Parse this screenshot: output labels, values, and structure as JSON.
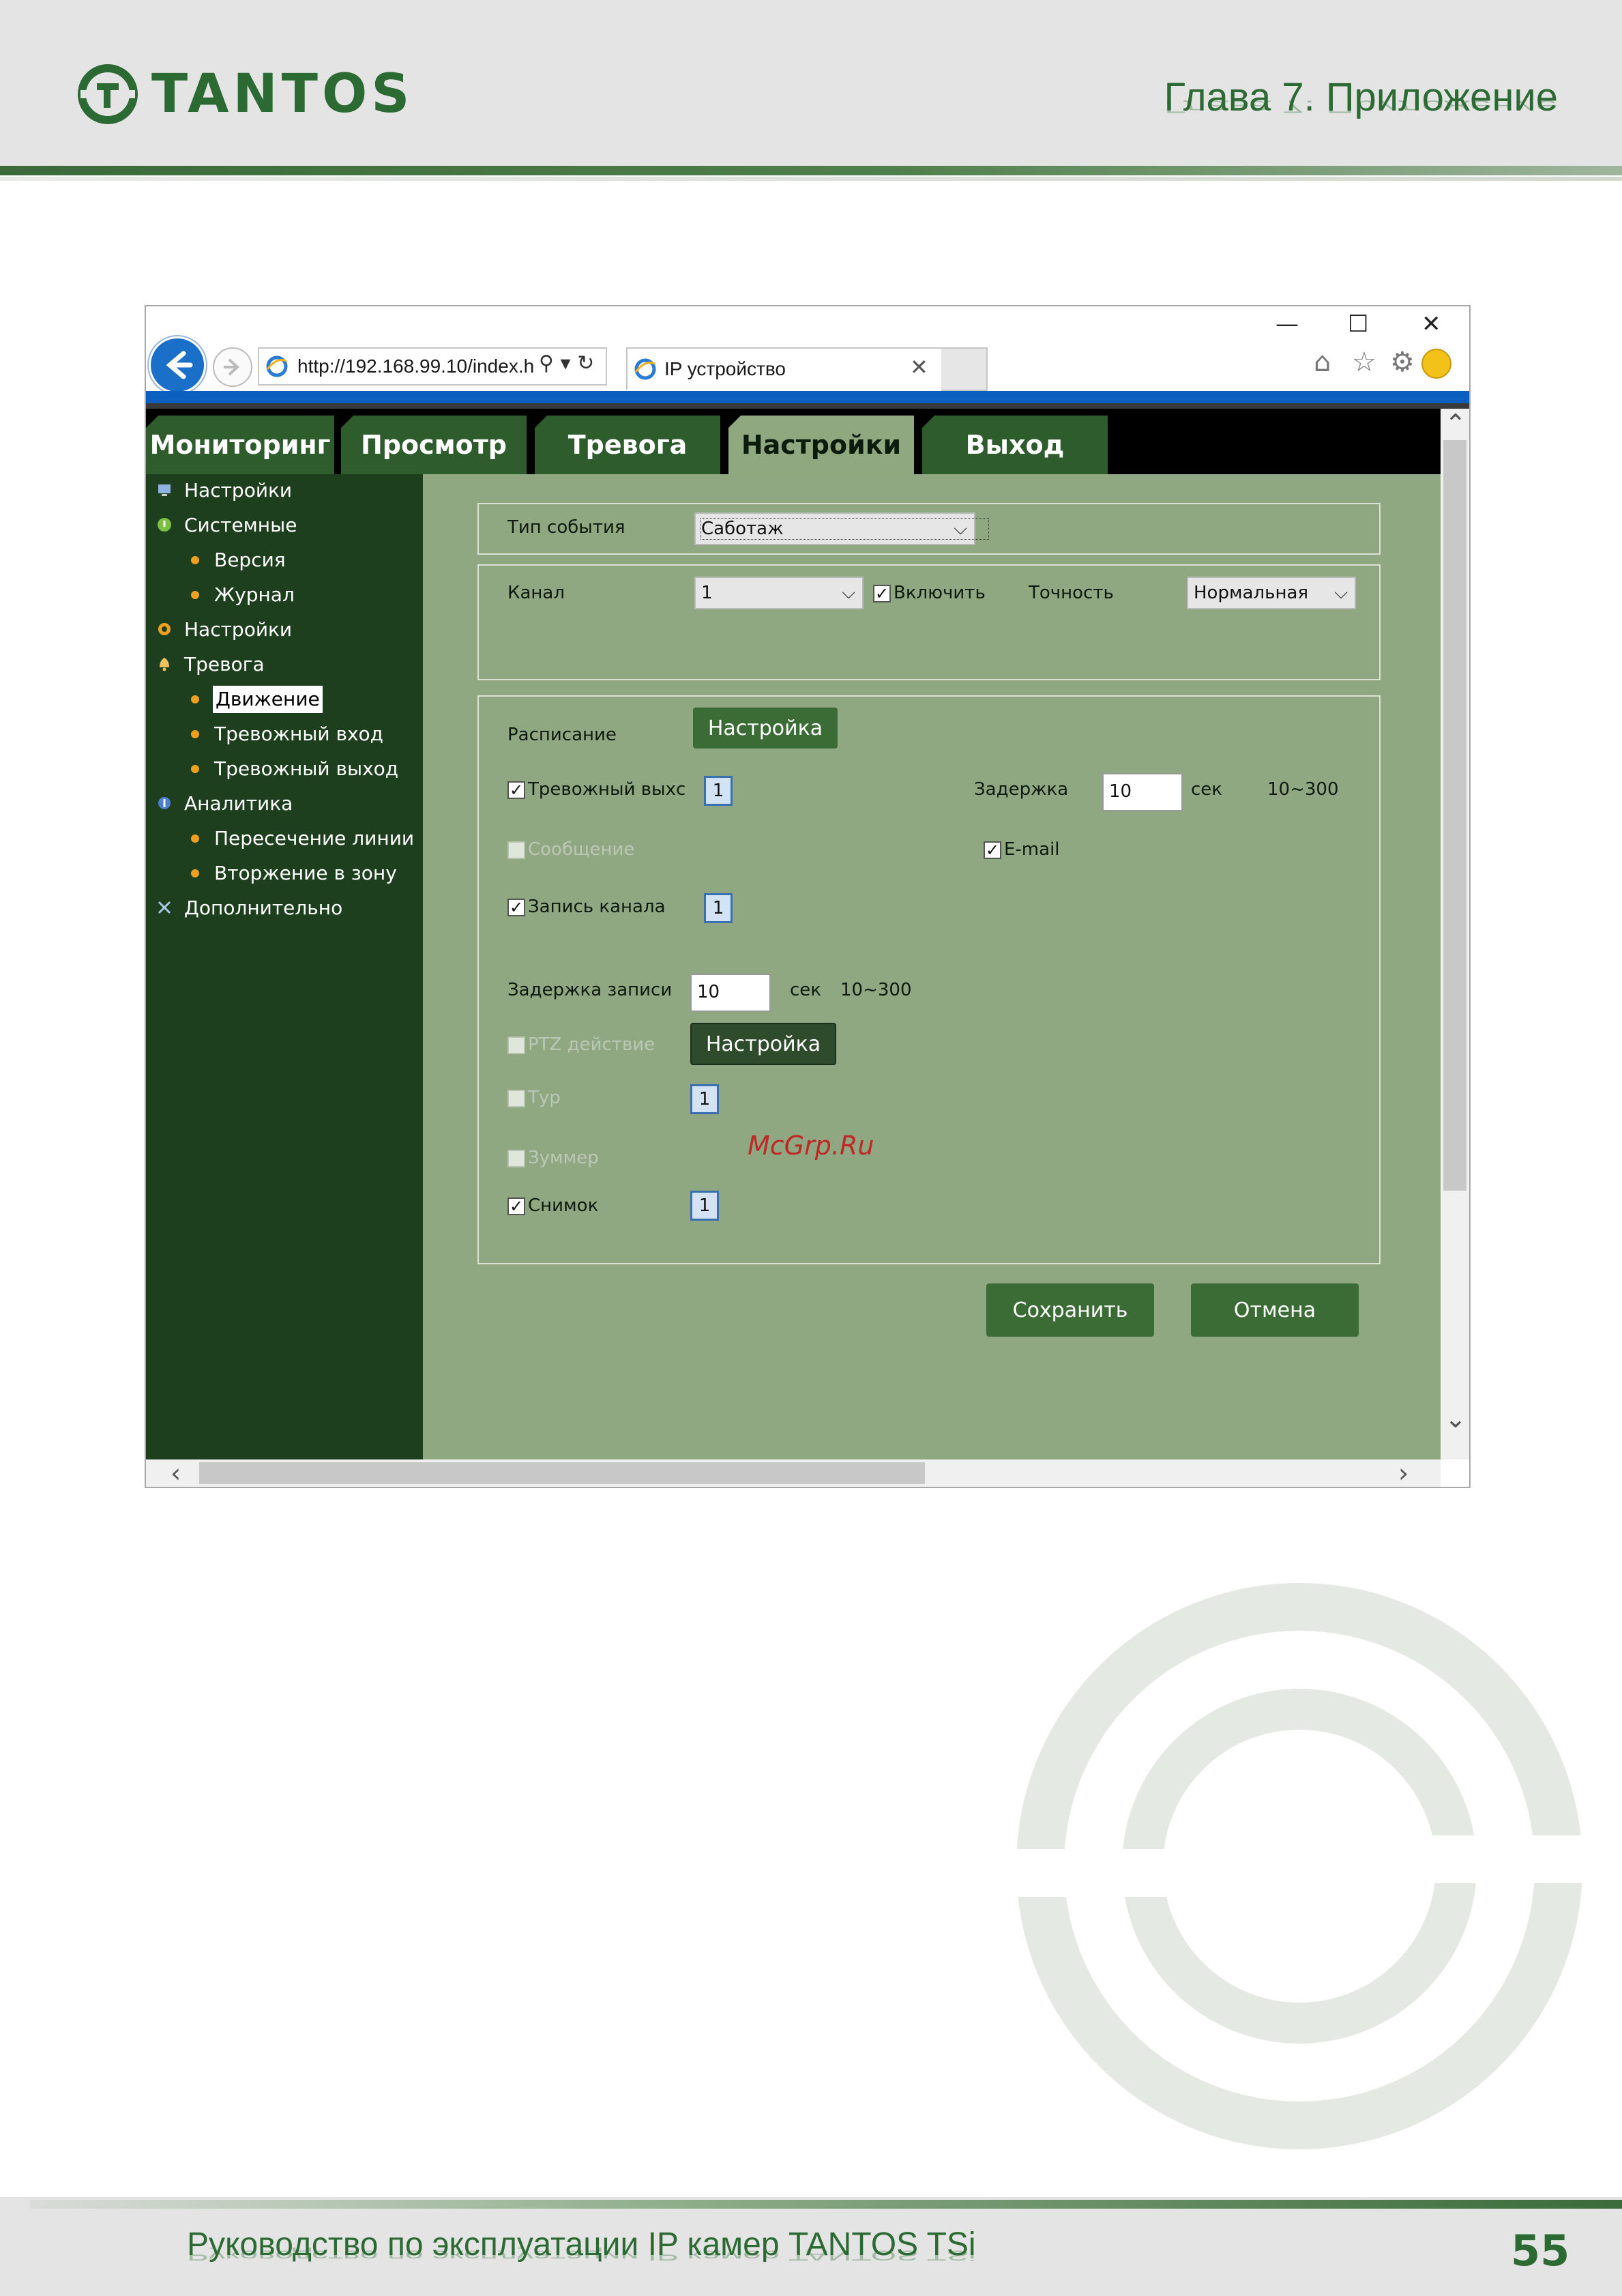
{
  "page": {
    "logo_text": "TANTOS",
    "chapter_title": "Глава 7. Приложение",
    "footer_text": "Руководство по эксплуатации IP камер TANTOS TSi",
    "page_number": "55",
    "watermark_text": "McGrp.Ru"
  },
  "browser": {
    "url": "http://192.168.99.10/index.h",
    "tab_title": "IP устройство",
    "window_controls": [
      "—",
      "☐",
      "✕"
    ],
    "icons": [
      "home-icon",
      "star-icon",
      "gear-icon",
      "smiley-icon"
    ]
  },
  "menu": {
    "tabs": [
      "Мониторинг",
      "Просмотр",
      "Тревога",
      "Настройки",
      "Выход"
    ],
    "active": "Настройки"
  },
  "sidebar": {
    "items": [
      {
        "label": "Настройки",
        "icon": "settings-monitor-icon"
      },
      {
        "label": "Системные",
        "icon": "info-icon"
      },
      {
        "label": "Версия"
      },
      {
        "label": "Журнал"
      },
      {
        "label": "Настройки",
        "icon": "gear-icon"
      },
      {
        "label": "Тревога",
        "icon": "bell-icon"
      },
      {
        "label": "Движение",
        "selected": true
      },
      {
        "label": "Тревожный вход"
      },
      {
        "label": "Тревожный выход"
      },
      {
        "label": "Аналитика",
        "icon": "analytics-icon"
      },
      {
        "label": "Пересечение линии"
      },
      {
        "label": "Вторжение в зону"
      },
      {
        "label": "Дополнительно",
        "icon": "tools-icon"
      }
    ]
  },
  "form": {
    "event_type_label": "Тип события",
    "event_type_value": "Саботаж",
    "channel_label": "Канал",
    "channel_value": "1",
    "enable_label": "Включить",
    "enable_checked": true,
    "precision_label": "Точность",
    "precision_value": "Нормальная",
    "schedule_label": "Расписание",
    "schedule_button": "Настройка",
    "alarm_out_label": "Тревожный выхс",
    "alarm_out_checked": true,
    "alarm_out_num": "1",
    "delay_label": "Задержка",
    "delay_value": "10",
    "delay_unit": "сек",
    "delay_range": "10~300",
    "message_label": "Сообщение",
    "message_checked": false,
    "email_label": "E-mail",
    "email_checked": true,
    "record_label": "Запись канала",
    "record_checked": true,
    "record_num": "1",
    "record_delay_label": "Задержка записи",
    "record_delay_value": "10",
    "record_delay_unit": "сек",
    "record_delay_range": "10~300",
    "ptz_label": "PTZ действие",
    "ptz_checked": false,
    "ptz_button": "Настройка",
    "tour_label": "Тур",
    "tour_checked": false,
    "tour_num": "1",
    "buzzer_label": "Зуммер",
    "buzzer_checked": false,
    "snapshot_label": "Снимок",
    "snapshot_checked": true,
    "snapshot_num": "1",
    "save_button": "Сохранить",
    "cancel_button": "Отмена"
  },
  "colors": {
    "brand_green": "#2c6a33",
    "sidebar_bg": "#1e3f1e",
    "content_bg": "#8fa882",
    "menu_tab": "#2e5c2c",
    "menu_tab_active": "#8fa880",
    "button_green": "#3b6c36"
  }
}
